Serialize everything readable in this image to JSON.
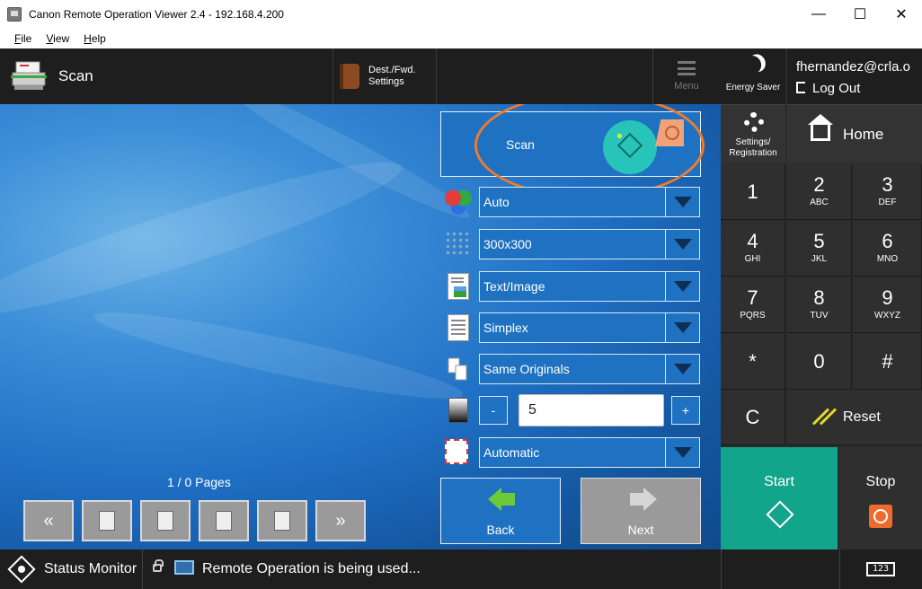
{
  "window": {
    "title": "Canon Remote Operation Viewer 2.4 - 192.168.4.200",
    "controls": {
      "minimize": "—",
      "maximize": "☐",
      "close": "✕"
    }
  },
  "menubar": {
    "items": [
      {
        "label": "File",
        "accel": "F",
        "rest": "ile"
      },
      {
        "label": "View",
        "accel": "V",
        "rest": "iew"
      },
      {
        "label": "Help",
        "accel": "H",
        "rest": "elp"
      }
    ]
  },
  "header": {
    "function_title": "Scan",
    "dest_fwd_line1": "Dest./Fwd.",
    "dest_fwd_line2": "Settings",
    "menu_label": "Menu"
  },
  "scan_panel": {
    "scan_label": "Scan",
    "color_mode": "Auto",
    "resolution": "300x300",
    "original_type": "Text/Image",
    "sides": "Simplex",
    "originals": "Same Originals",
    "density_minus": "-",
    "density_value": "5",
    "density_plus": "+",
    "frame_erase": "Automatic"
  },
  "pages": {
    "label": "1 / 0 Pages",
    "first": "«",
    "last": "»"
  },
  "nav": {
    "back_label": "Back",
    "next_label": "Next"
  },
  "right_panel": {
    "energy_saver": "Energy Saver",
    "user_email": "fhernandez@crla.o",
    "logout": "Log Out",
    "settings_line1": "Settings/",
    "settings_line2": "Registration",
    "home": "Home",
    "keys": [
      {
        "digit": "1",
        "letters": ""
      },
      {
        "digit": "2",
        "letters": "ABC"
      },
      {
        "digit": "3",
        "letters": "DEF"
      },
      {
        "digit": "4",
        "letters": "GHI"
      },
      {
        "digit": "5",
        "letters": "JKL"
      },
      {
        "digit": "6",
        "letters": "MNO"
      },
      {
        "digit": "7",
        "letters": "PQRS"
      },
      {
        "digit": "8",
        "letters": "TUV"
      },
      {
        "digit": "9",
        "letters": "WXYZ"
      },
      {
        "digit": "*",
        "letters": ""
      },
      {
        "digit": "0",
        "letters": ""
      },
      {
        "digit": "#",
        "letters": ""
      }
    ],
    "clear": "C",
    "reset": "Reset",
    "start": "Start",
    "stop": "Stop"
  },
  "statusbar": {
    "status_monitor": "Status Monitor",
    "remote_message": "Remote Operation is being used...",
    "keyboard_label": "123"
  },
  "colors": {
    "accent_blue": "#1f72c1",
    "start_teal": "#13a48c",
    "stop_orange": "#ee6a2d",
    "highlight_ring": "#ee7b2d"
  }
}
